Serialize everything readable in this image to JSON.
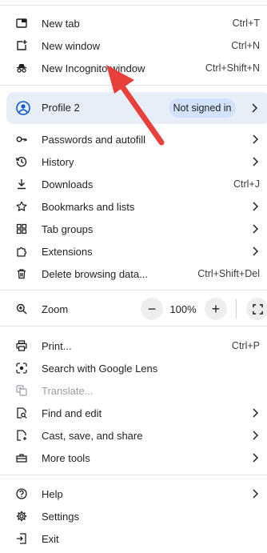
{
  "menu": {
    "new_tab": {
      "label": "New tab",
      "shortcut": "Ctrl+T",
      "icon": "new-tab-icon"
    },
    "new_window": {
      "label": "New window",
      "shortcut": "Ctrl+N",
      "icon": "new-window-icon"
    },
    "new_incognito": {
      "label": "New Incognito window",
      "shortcut": "Ctrl+Shift+N",
      "icon": "incognito-icon"
    },
    "profile": {
      "label": "Profile 2",
      "status": "Not signed in",
      "icon": "profile-icon"
    },
    "passwords": {
      "label": "Passwords and autofill",
      "icon": "key-icon"
    },
    "history": {
      "label": "History",
      "icon": "history-icon"
    },
    "downloads": {
      "label": "Downloads",
      "shortcut": "Ctrl+J",
      "icon": "download-icon"
    },
    "bookmarks": {
      "label": "Bookmarks and lists",
      "icon": "star-icon"
    },
    "tab_groups": {
      "label": "Tab groups",
      "icon": "tab-groups-icon"
    },
    "extensions": {
      "label": "Extensions",
      "icon": "puzzle-icon"
    },
    "delete_data": {
      "label": "Delete browsing data...",
      "shortcut": "Ctrl+Shift+Del",
      "icon": "trash-icon"
    },
    "zoom": {
      "label": "Zoom",
      "minus": "−",
      "value": "100%",
      "plus": "+",
      "icon": "zoom-icon"
    },
    "print": {
      "label": "Print...",
      "shortcut": "Ctrl+P",
      "icon": "print-icon"
    },
    "lens": {
      "label": "Search with Google Lens",
      "icon": "lens-icon"
    },
    "translate": {
      "label": "Translate...",
      "icon": "translate-icon"
    },
    "find_edit": {
      "label": "Find and edit",
      "icon": "find-icon"
    },
    "cast_save": {
      "label": "Cast, save, and share",
      "icon": "cast-icon"
    },
    "more_tools": {
      "label": "More tools",
      "icon": "toolbox-icon"
    },
    "help": {
      "label": "Help",
      "icon": "help-icon"
    },
    "settings": {
      "label": "Settings",
      "icon": "gear-icon"
    },
    "exit": {
      "label": "Exit",
      "icon": "exit-icon"
    }
  },
  "colors": {
    "annotation_arrow": "#e8403b",
    "profile_bg": "#e8eef7",
    "pill_bg": "#d3e3fd"
  }
}
